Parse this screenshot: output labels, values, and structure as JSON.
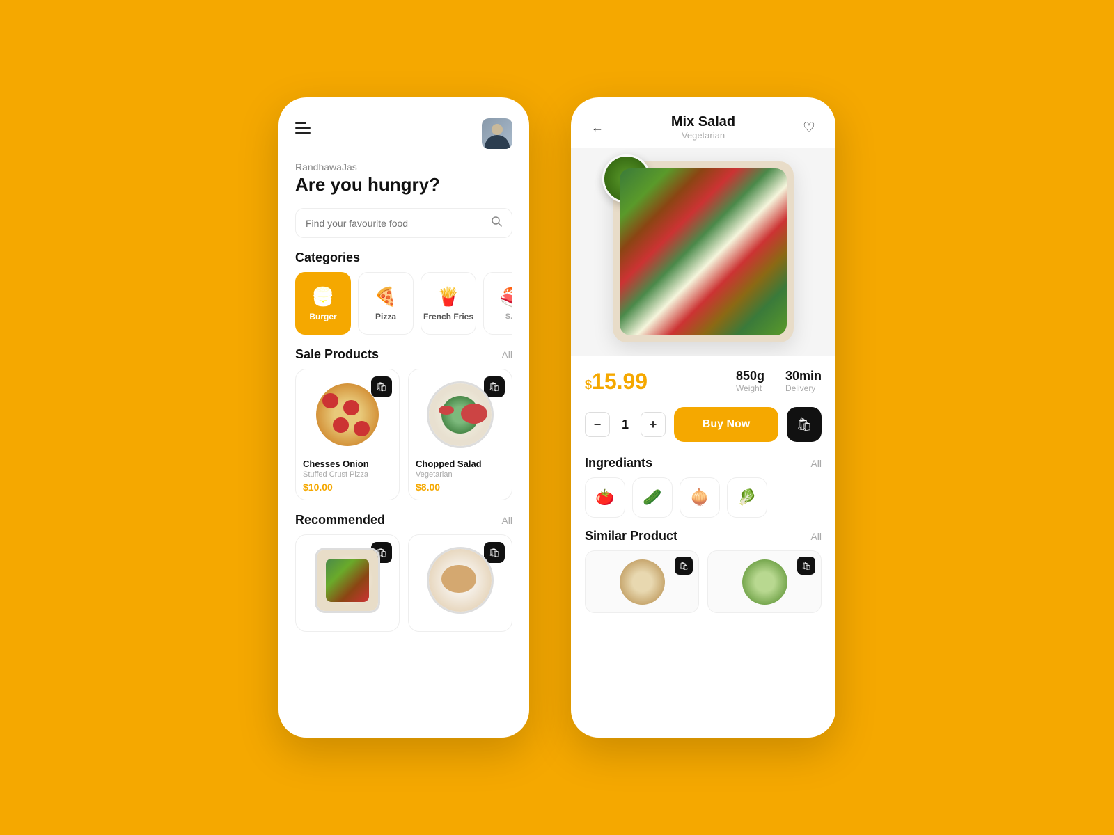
{
  "background": "#F5A800",
  "left_phone": {
    "username": "RandhawaJas",
    "greeting": "Are you hungry?",
    "search": {
      "placeholder": "Find your favourite food"
    },
    "categories_title": "Categories",
    "categories": [
      {
        "id": "burger",
        "label": "Burger",
        "icon": "🍔",
        "active": true
      },
      {
        "id": "pizza",
        "label": "Pizza",
        "icon": "🍕",
        "active": false
      },
      {
        "id": "fries",
        "label": "French Fries",
        "icon": "🍟",
        "active": false
      },
      {
        "id": "sushi",
        "label": "S...",
        "icon": "🍣",
        "active": false
      }
    ],
    "sale_title": "Sale Products",
    "sale_all": "All",
    "sale_products": [
      {
        "name": "Chesses Onion",
        "sub": "Stuffed Crust Pizza",
        "price": "$10.00",
        "type": "pizza"
      },
      {
        "name": "Chopped Salad",
        "sub": "Vegetarian",
        "price": "$8.00",
        "type": "salad"
      }
    ],
    "recommended_title": "Recommended",
    "recommended_all": "All",
    "recommended_products": [
      {
        "type": "mixsalad"
      },
      {
        "type": "chicken"
      }
    ]
  },
  "right_phone": {
    "title": "Mix Salad",
    "subtitle": "Vegetarian",
    "price": "$15.99",
    "price_dollar": "$",
    "price_number": "15.99",
    "weight": "850g",
    "weight_label": "Weight",
    "delivery": "30min",
    "delivery_label": "Delivery",
    "quantity": "1",
    "buy_label": "Buy Now",
    "ingredients_title": "Ingrediants",
    "ingredients_all": "All",
    "ingredients": [
      {
        "name": "tomato",
        "emoji": "🍅"
      },
      {
        "name": "cucumber",
        "emoji": "🥒"
      },
      {
        "name": "onion",
        "emoji": "🧅"
      },
      {
        "name": "lettuce",
        "emoji": "🥬"
      }
    ],
    "similar_title": "Similar Product",
    "similar_all": "All"
  }
}
